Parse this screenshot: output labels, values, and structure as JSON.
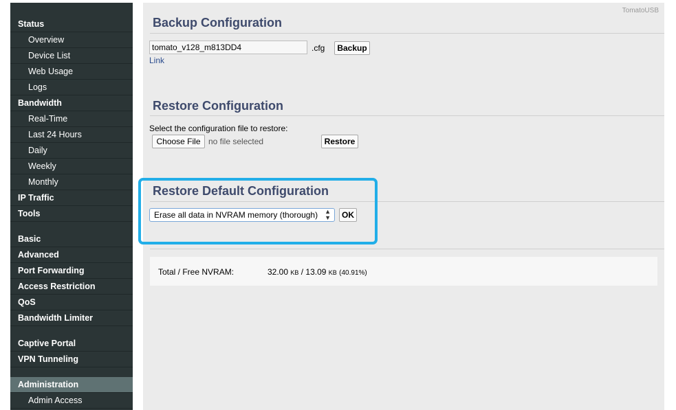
{
  "brand": "TomatoUSB",
  "sidebar": {
    "items": [
      {
        "label": "Status",
        "kind": "cat"
      },
      {
        "label": "Overview",
        "kind": "sub"
      },
      {
        "label": "Device List",
        "kind": "sub"
      },
      {
        "label": "Web Usage",
        "kind": "sub"
      },
      {
        "label": "Logs",
        "kind": "sub"
      },
      {
        "label": "Bandwidth",
        "kind": "cat"
      },
      {
        "label": "Real-Time",
        "kind": "sub"
      },
      {
        "label": "Last 24 Hours",
        "kind": "sub"
      },
      {
        "label": "Daily",
        "kind": "sub"
      },
      {
        "label": "Weekly",
        "kind": "sub"
      },
      {
        "label": "Monthly",
        "kind": "sub"
      },
      {
        "label": "IP Traffic",
        "kind": "cat"
      },
      {
        "label": "Tools",
        "kind": "cat"
      },
      {
        "label": "Basic",
        "kind": "cat"
      },
      {
        "label": "Advanced",
        "kind": "cat"
      },
      {
        "label": "Port Forwarding",
        "kind": "cat"
      },
      {
        "label": "Access Restriction",
        "kind": "cat"
      },
      {
        "label": "QoS",
        "kind": "cat"
      },
      {
        "label": "Bandwidth Limiter",
        "kind": "cat"
      },
      {
        "label": "Captive Portal",
        "kind": "cat"
      },
      {
        "label": "VPN Tunneling",
        "kind": "cat"
      },
      {
        "label": "Administration",
        "kind": "cat",
        "active": true
      },
      {
        "label": "Admin Access",
        "kind": "sub"
      }
    ]
  },
  "backup": {
    "title": "Backup Configuration",
    "filename": "tomato_v128_m813DD4",
    "ext": ".cfg",
    "button": "Backup",
    "link": "Link"
  },
  "restore": {
    "title": "Restore Configuration",
    "prompt": "Select the configuration file to restore:",
    "choose_button": "Choose File",
    "file_status": "no file selected",
    "button": "Restore"
  },
  "restore_default": {
    "title": "Restore Default Configuration",
    "selected_option": "Erase all data in NVRAM memory (thorough)",
    "ok_button": "OK"
  },
  "nvram": {
    "label": "Total / Free NVRAM:",
    "total": "32.00",
    "unit1": "KB",
    "sep": "/",
    "free": "13.09",
    "unit2": "KB",
    "percent": "(40.91%)"
  },
  "colors": {
    "sidebar_bg": "#2b3536",
    "sidebar_active": "#5f7273",
    "title_color": "#3e4a6c",
    "highlight": "#22aee8"
  }
}
